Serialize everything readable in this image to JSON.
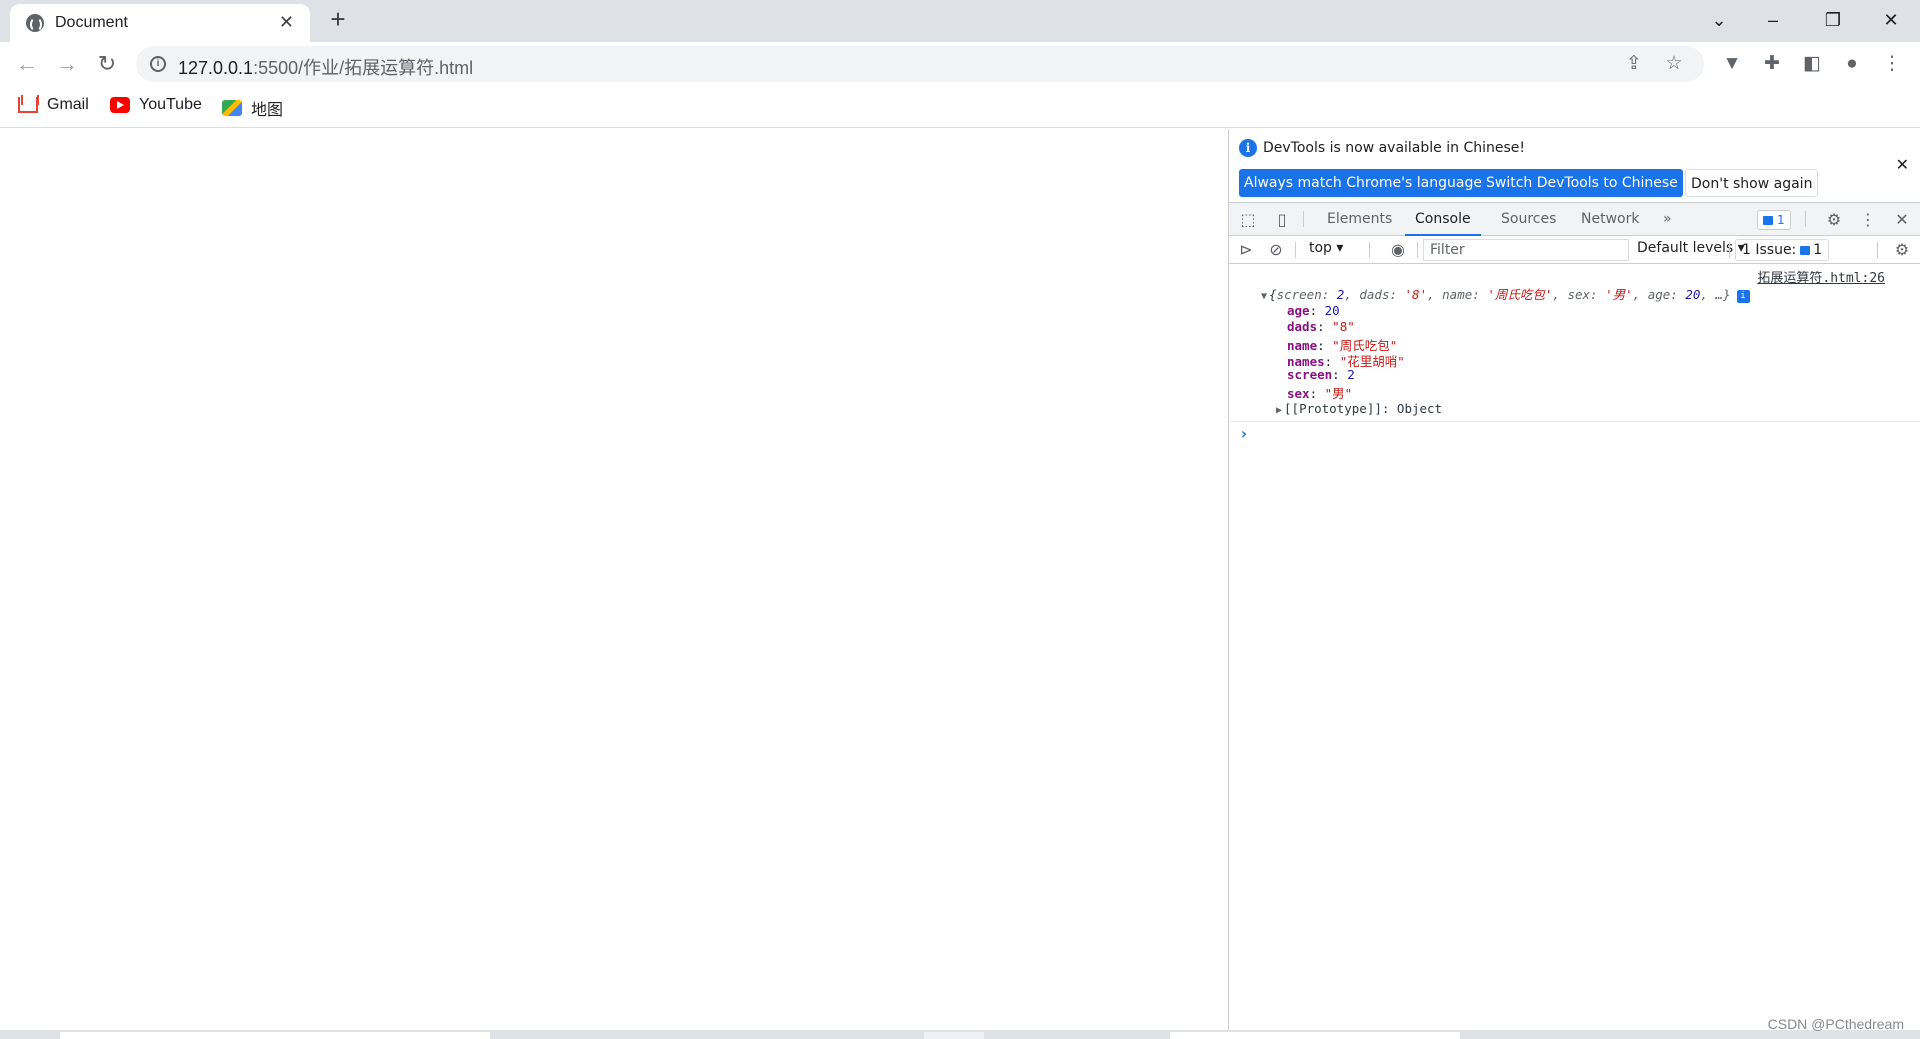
{
  "browser": {
    "tab_title": "Document",
    "url_host": "127.0.0.1",
    "url_rest": ":5500/作业/拓展运算符.html",
    "bookmarks": [
      "Gmail",
      "YouTube",
      "地图"
    ]
  },
  "devtools": {
    "infobar": {
      "message": "DevTools is now available in Chinese!",
      "btn_match": "Always match Chrome's language",
      "btn_switch": "Switch DevTools to Chinese",
      "btn_dont_show": "Don't show again"
    },
    "tabs": [
      "Elements",
      "Console",
      "Sources",
      "Network"
    ],
    "active_tab": "Console",
    "more_tabs": "»",
    "messages_badge": "1",
    "toolbar": {
      "context": "top",
      "filter_placeholder": "Filter",
      "levels": "Default levels",
      "issues_label": "1 Issue:",
      "issues_count": "1"
    },
    "console": {
      "source_link": "拓展运算符.html:26",
      "summary": {
        "open": "{",
        "screen_key": "screen: ",
        "screen_val": "2",
        "dads_key": ", dads: ",
        "dads_val": "'8'",
        "name_key": ", name: ",
        "name_val": "'周氏吃包'",
        "sex_key": ", sex: ",
        "sex_val": "'男'",
        "age_key": ", age: ",
        "age_val": "20",
        "close": ", …}"
      },
      "properties": [
        {
          "key": "age",
          "value": "20",
          "type": "number"
        },
        {
          "key": "dads",
          "value": "\"8\"",
          "type": "string"
        },
        {
          "key": "name",
          "value": "\"周氏吃包\"",
          "type": "string"
        },
        {
          "key": "names",
          "value": "\"花里胡哨\"",
          "type": "string"
        },
        {
          "key": "screen",
          "value": "2",
          "type": "number"
        },
        {
          "key": "sex",
          "value": "\"男\"",
          "type": "string"
        }
      ],
      "prototype": "[[Prototype]]: Object",
      "prompt": "›"
    }
  },
  "watermark": "CSDN @PCthedream",
  "colors": {
    "accent": "#1a73e8",
    "string": "#c41a16",
    "number": "#1a1aa6",
    "key": "#881280"
  }
}
